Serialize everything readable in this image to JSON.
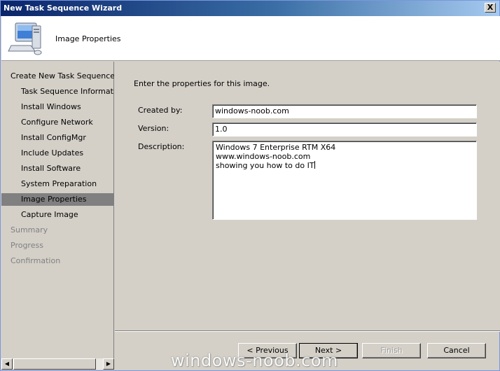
{
  "window": {
    "title": "New Task Sequence Wizard",
    "close_label": "X"
  },
  "header": {
    "title": "Image Properties",
    "icon": "computer-icon"
  },
  "sidebar": {
    "items": [
      {
        "label": "Create New Task Sequence",
        "level": 0,
        "state": "normal"
      },
      {
        "label": "Task Sequence Information",
        "level": 1,
        "state": "normal"
      },
      {
        "label": "Install Windows",
        "level": 1,
        "state": "normal"
      },
      {
        "label": "Configure Network",
        "level": 1,
        "state": "normal"
      },
      {
        "label": "Install ConfigMgr",
        "level": 1,
        "state": "normal"
      },
      {
        "label": "Include Updates",
        "level": 1,
        "state": "normal"
      },
      {
        "label": "Install Software",
        "level": 1,
        "state": "normal"
      },
      {
        "label": "System Preparation",
        "level": 1,
        "state": "normal"
      },
      {
        "label": "Image Properties",
        "level": 1,
        "state": "selected"
      },
      {
        "label": "Capture Image",
        "level": 1,
        "state": "normal"
      },
      {
        "label": "Summary",
        "level": 0,
        "state": "disabled"
      },
      {
        "label": "Progress",
        "level": 0,
        "state": "disabled"
      },
      {
        "label": "Confirmation",
        "level": 0,
        "state": "disabled"
      }
    ]
  },
  "form": {
    "intro": "Enter the properties for this image.",
    "created_by": {
      "label": "Created by:",
      "value": "windows-noob.com"
    },
    "version": {
      "label": "Version:",
      "value": "1.0"
    },
    "description": {
      "label": "Description:",
      "lines": [
        "Windows 7 Enterprise RTM X64",
        "www.windows-noob.com",
        "showing you how to do IT"
      ]
    }
  },
  "buttons": {
    "previous": "< Previous",
    "next": "Next >",
    "finish": "Finish",
    "cancel": "Cancel"
  },
  "scrollbar": {
    "left_arrow": "◀",
    "right_arrow": "▶"
  },
  "watermark": "windows-noob.com"
}
